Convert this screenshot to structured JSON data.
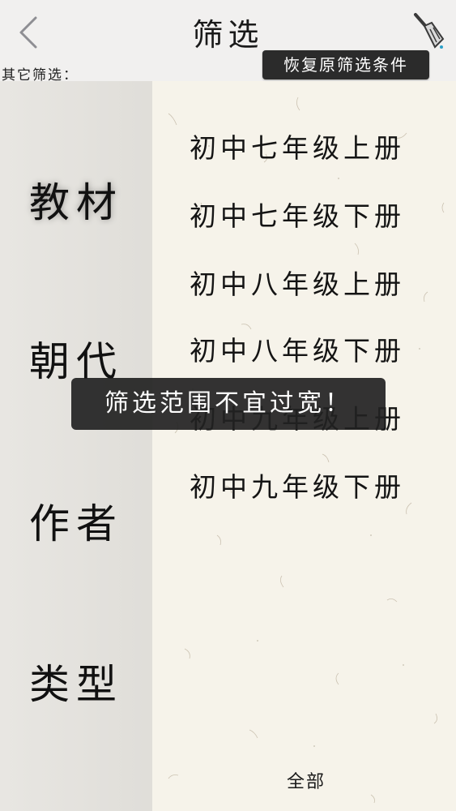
{
  "header": {
    "title": "筛选",
    "back_icon": "chevron-left-icon",
    "clear_icon": "broom-icon",
    "other_filter_label": "其它筛选：",
    "restore_button": "恢复原筛选条件"
  },
  "sidebar": {
    "categories": [
      {
        "label": "教材",
        "active": true
      },
      {
        "label": "朝代",
        "active": false
      },
      {
        "label": "作者",
        "active": false
      },
      {
        "label": "类型",
        "active": false
      }
    ]
  },
  "options": [
    "初中七年级上册",
    "初中七年级下册",
    "初中八年级上册",
    "初中八年级下册",
    "初中九年级上册",
    "初中九年级下册"
  ],
  "footer": {
    "all_label": "全部"
  },
  "toast": {
    "message": "筛选范围不宜过宽！"
  },
  "colors": {
    "paper": "#f6f3ea",
    "sidebar": "#e4e2dd",
    "toast_bg": "#222222",
    "button_bg": "#2b2b2b"
  }
}
